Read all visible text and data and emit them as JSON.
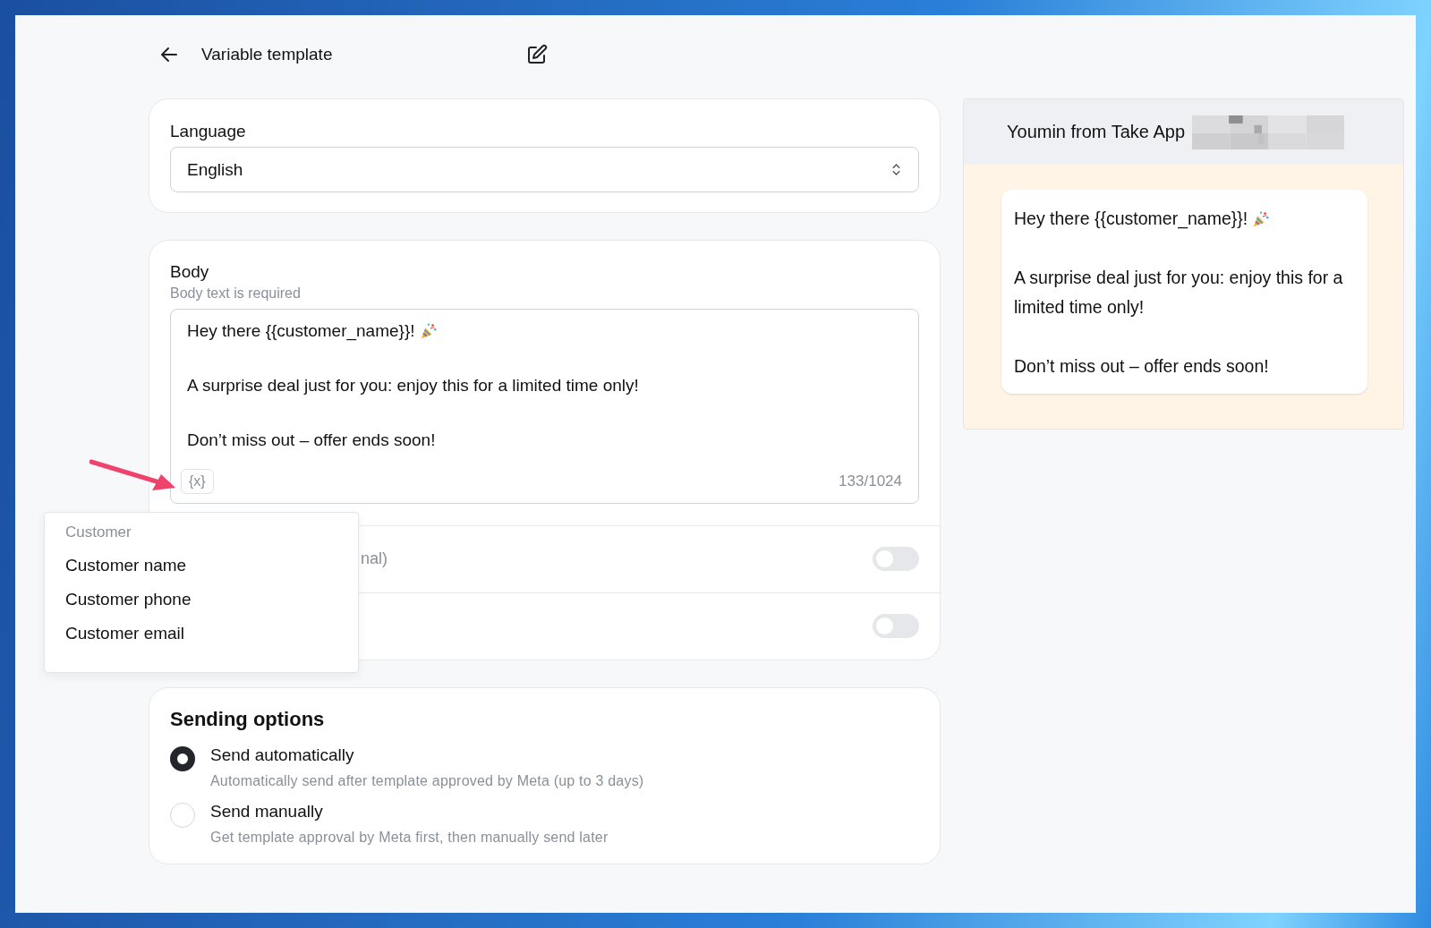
{
  "header": {
    "title": "Variable template"
  },
  "language": {
    "label": "Language",
    "value": "English"
  },
  "body": {
    "label": "Body",
    "hint": "Body text is required",
    "paragraphs": [
      "Hey there {{customer_name}}!",
      "A surprise deal just for you: enjoy this for a limited time only!",
      "Don’t miss out – offer ends soon!"
    ],
    "variable_button": "{x}",
    "counter": "133/1024"
  },
  "toggles": [
    {
      "label": "nal)",
      "on": false
    },
    {
      "on": false
    }
  ],
  "variable_menu": {
    "heading": "Customer",
    "items": [
      "Customer name",
      "Customer phone",
      "Customer email"
    ]
  },
  "sending_options": {
    "title": "Sending options",
    "options": [
      {
        "label": "Send automatically",
        "description": "Automatically send after template approved by Meta (up to 3 days)",
        "selected": true
      },
      {
        "label": "Send manually",
        "description": "Get template approval by Meta first, then manually send later",
        "selected": false
      }
    ]
  },
  "preview": {
    "sender": "Youmin from Take App",
    "paragraphs": [
      "Hey there {{customer_name}}!",
      "A surprise deal just for you: enjoy this for a limited time only!",
      "Don’t miss out – offer ends soon!"
    ]
  }
}
